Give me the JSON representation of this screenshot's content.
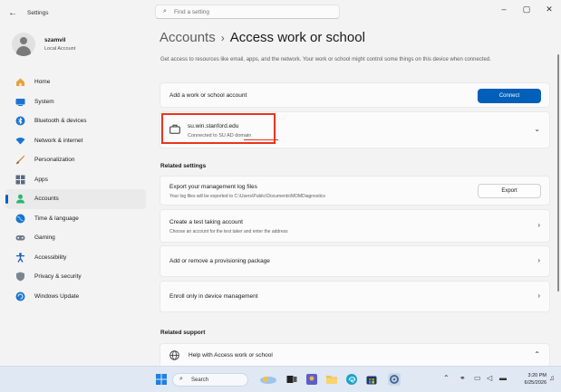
{
  "window": {
    "app_title": "Settings",
    "search_placeholder": "Find a setting",
    "minimize": "–",
    "maximize": "▢",
    "close": "✕",
    "back": "←"
  },
  "profile": {
    "name": "szamvil",
    "sub": "Local Account"
  },
  "nav": [
    {
      "label": "Home",
      "icon": "home-icon"
    },
    {
      "label": "System",
      "icon": "system-icon"
    },
    {
      "label": "Bluetooth & devices",
      "icon": "bluetooth-icon"
    },
    {
      "label": "Network & internet",
      "icon": "network-icon"
    },
    {
      "label": "Personalization",
      "icon": "brush-icon"
    },
    {
      "label": "Apps",
      "icon": "apps-icon"
    },
    {
      "label": "Accounts",
      "icon": "accounts-icon",
      "active": true
    },
    {
      "label": "Time & language",
      "icon": "globe-icon"
    },
    {
      "label": "Gaming",
      "icon": "gamepad-icon"
    },
    {
      "label": "Accessibility",
      "icon": "accessibility-icon"
    },
    {
      "label": "Privacy & security",
      "icon": "shield-icon"
    },
    {
      "label": "Windows Update",
      "icon": "update-icon"
    }
  ],
  "main": {
    "breadcrumb_parent": "Accounts",
    "breadcrumb_sep": "›",
    "breadcrumb_current": "Access work or school",
    "description": "Get access to resources like email, apps, and the network. Your work or school might control some things on this device when connected.",
    "add_account": {
      "label": "Add a work or school account",
      "button": "Connect"
    },
    "connected": {
      "domain": "su.win.stanford.edu",
      "status": "Connected to SU AD domain"
    },
    "related_settings_header": "Related settings",
    "export_logs": {
      "title": "Export your management log files",
      "sub": "Your log files will be exported to C:\\Users\\Public\\Documents\\MDMDiagnostics",
      "button": "Export"
    },
    "test_account": {
      "title": "Create a test taking account",
      "sub": "Choose an account for the test taker and enter the address"
    },
    "provisioning": {
      "title": "Add or remove a provisioning package"
    },
    "enroll": {
      "title": "Enroll only in device management"
    },
    "related_support_header": "Related support",
    "help": {
      "title": "Help with Access work or school"
    }
  },
  "taskbar": {
    "search_label": "Search",
    "time": "3:20 PM",
    "date": "6/25/2026"
  },
  "colors": {
    "accent": "#005fb8",
    "highlight": "#e8351c"
  }
}
